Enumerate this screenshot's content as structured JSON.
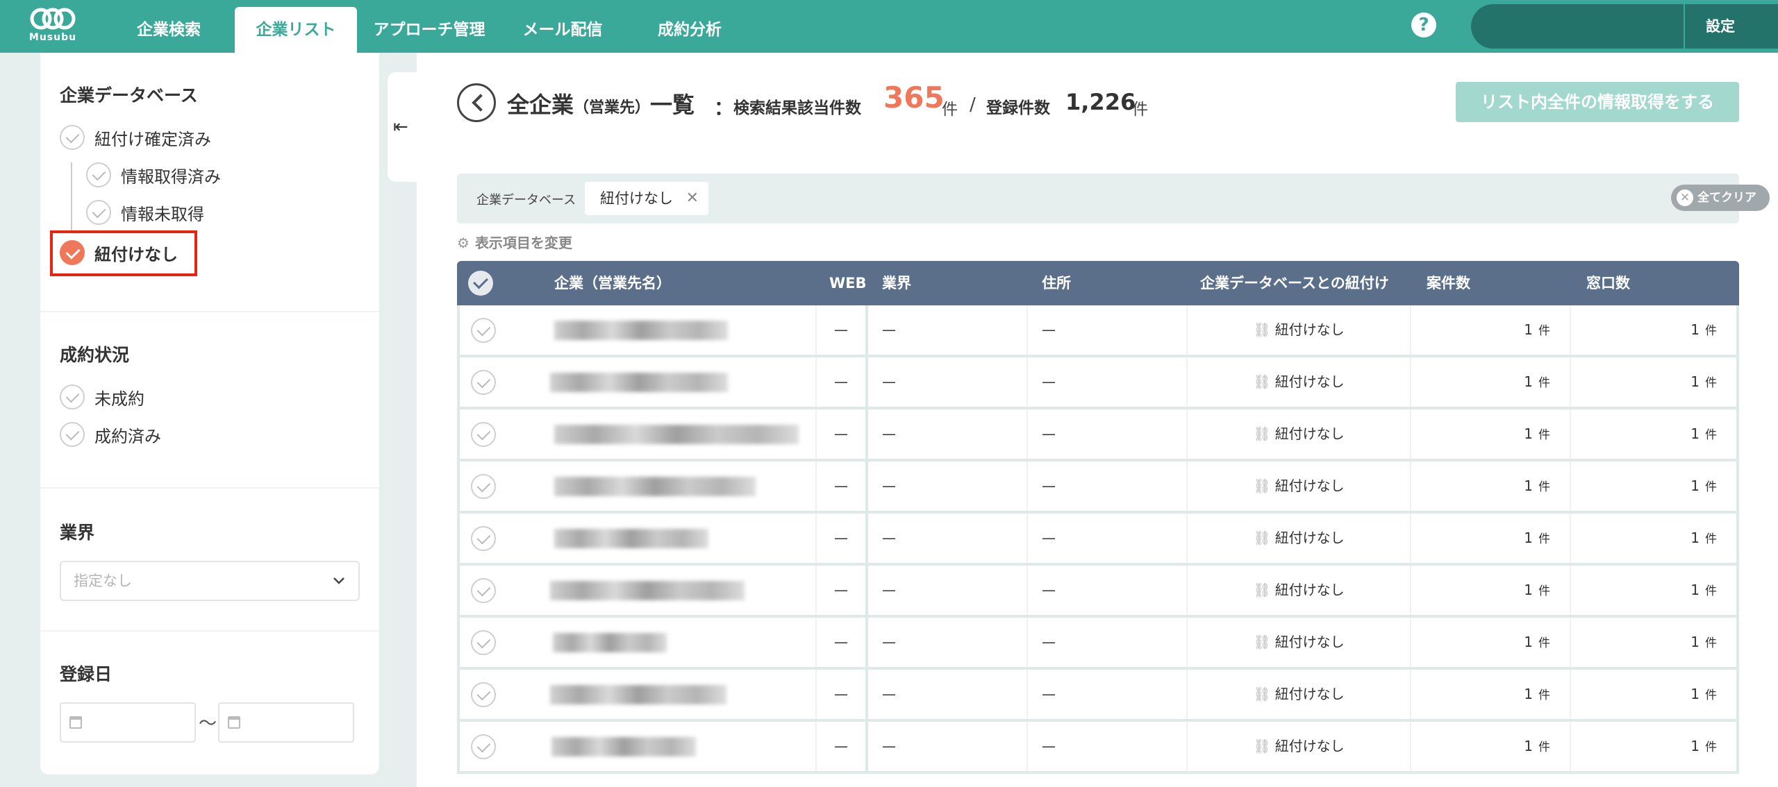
{
  "app": {
    "logo_text": "Musubu"
  },
  "nav": {
    "items": [
      {
        "label": "企業検索",
        "active": false
      },
      {
        "label": "企業リスト",
        "active": true
      },
      {
        "label": "アプローチ管理",
        "active": false
      },
      {
        "label": "メール配信",
        "active": false
      },
      {
        "label": "成約分析",
        "active": false
      }
    ],
    "help_label": "?",
    "settings_label": "設定"
  },
  "sidebar": {
    "db_title": "企業データベース",
    "db_items": [
      {
        "label": "紐付け確定済み",
        "checked": false
      },
      {
        "label": "情報取得済み",
        "checked": false
      },
      {
        "label": "情報未取得",
        "checked": false
      },
      {
        "label": "紐付けなし",
        "checked": true
      }
    ],
    "deal_title": "成約状況",
    "deal_items": [
      {
        "label": "未成約",
        "checked": false
      },
      {
        "label": "成約済み",
        "checked": false
      }
    ],
    "industry_title": "業界",
    "industry_placeholder": "指定なし",
    "reg_title": "登録日",
    "date_sep": "〜",
    "collapse_icon": "⇤"
  },
  "header": {
    "title_main": "全企業",
    "title_sub": "（営業先）",
    "title_tail": "一覧",
    "colon": "：",
    "result_label": "検索結果該当件数",
    "result_count": "365",
    "unit": "件",
    "slash": "/",
    "registered_label": "登録件数",
    "registered_count": "1,226",
    "fetch_all_label": "リスト内全件の情報取得をする"
  },
  "filters": {
    "group_label": "企業データベース",
    "chip_label": "紐付けなし",
    "chip_remove": "✕",
    "clear_label": "全てクリア",
    "clear_icon": "✕"
  },
  "change_columns_label": "表示項目を変更",
  "table": {
    "columns": [
      "企業（営業先名）",
      "WEB",
      "業界",
      "住所",
      "企業データベースとの紐付け",
      "案件数",
      "窓口数"
    ],
    "rows": [
      {
        "web": "—",
        "industry": "—",
        "address": "—",
        "link": "紐付けなし",
        "deals": "1",
        "contacts": "1"
      },
      {
        "web": "—",
        "industry": "—",
        "address": "—",
        "link": "紐付けなし",
        "deals": "1",
        "contacts": "1"
      },
      {
        "web": "—",
        "industry": "—",
        "address": "—",
        "link": "紐付けなし",
        "deals": "1",
        "contacts": "1"
      },
      {
        "web": "—",
        "industry": "—",
        "address": "—",
        "link": "紐付けなし",
        "deals": "1",
        "contacts": "1"
      },
      {
        "web": "—",
        "industry": "—",
        "address": "—",
        "link": "紐付けなし",
        "deals": "1",
        "contacts": "1"
      },
      {
        "web": "—",
        "industry": "—",
        "address": "—",
        "link": "紐付けなし",
        "deals": "1",
        "contacts": "1"
      },
      {
        "web": "—",
        "industry": "—",
        "address": "—",
        "link": "紐付けなし",
        "deals": "1",
        "contacts": "1"
      },
      {
        "web": "—",
        "industry": "—",
        "address": "—",
        "link": "紐付けなし",
        "deals": "1",
        "contacts": "1"
      },
      {
        "web": "—",
        "industry": "—",
        "address": "—",
        "link": "紐付けなし",
        "deals": "1",
        "contacts": "1"
      }
    ],
    "unit": "件"
  },
  "colors": {
    "brand": "#3aa999",
    "accent": "#f0785a",
    "table_header": "#5b6f8a",
    "highlight": "#e8240f"
  },
  "icons": [
    "musubu-logo-icon",
    "help-icon",
    "collapse-sidebar-icon",
    "back-arrow-icon",
    "gear-icon",
    "link-icon",
    "check-icon",
    "calendar-icon",
    "chevron-down-icon",
    "close-icon"
  ]
}
